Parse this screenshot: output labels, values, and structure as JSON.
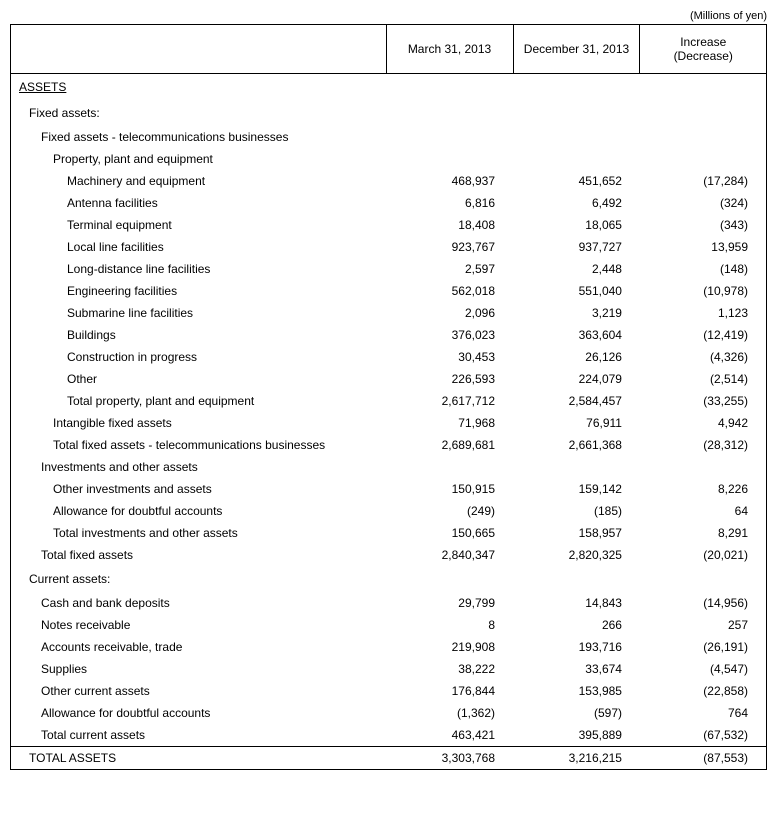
{
  "unit_label": "(Millions of yen)",
  "headers": {
    "col1": "March 31, 2013",
    "col2": "December 31, 2013",
    "col3": "Increase\n(Decrease)"
  },
  "section_assets": "ASSETS",
  "rows": {
    "fixed_assets": "Fixed assets:",
    "fa_telecom": "Fixed assets - telecommunications businesses",
    "ppe": "Property, plant and equipment",
    "machinery": {
      "label": "Machinery and equipment",
      "c1": "468,937",
      "c2": "451,652",
      "c3": "(17,284)"
    },
    "antenna": {
      "label": "Antenna facilities",
      "c1": "6,816",
      "c2": "6,492",
      "c3": "(324)"
    },
    "terminal": {
      "label": "Terminal equipment",
      "c1": "18,408",
      "c2": "18,065",
      "c3": "(343)"
    },
    "local": {
      "label": "Local line facilities",
      "c1": "923,767",
      "c2": "937,727",
      "c3": "13,959"
    },
    "longdist": {
      "label": "Long-distance line facilities",
      "c1": "2,597",
      "c2": "2,448",
      "c3": "(148)"
    },
    "engineering": {
      "label": "Engineering facilities",
      "c1": "562,018",
      "c2": "551,040",
      "c3": "(10,978)"
    },
    "submarine": {
      "label": "Submarine line facilities",
      "c1": "2,096",
      "c2": "3,219",
      "c3": "1,123"
    },
    "buildings": {
      "label": "Buildings",
      "c1": "376,023",
      "c2": "363,604",
      "c3": "(12,419)"
    },
    "cip": {
      "label": "Construction in progress",
      "c1": "30,453",
      "c2": "26,126",
      "c3": "(4,326)"
    },
    "other_ppe": {
      "label": "Other",
      "c1": "226,593",
      "c2": "224,079",
      "c3": "(2,514)"
    },
    "total_ppe": {
      "label": "Total property, plant and equipment",
      "c1": "2,617,712",
      "c2": "2,584,457",
      "c3": "(33,255)"
    },
    "intangible": {
      "label": "Intangible fixed assets",
      "c1": "71,968",
      "c2": "76,911",
      "c3": "4,942"
    },
    "total_fa_telecom": {
      "label": "Total fixed assets - telecommunications businesses",
      "c1": "2,689,681",
      "c2": "2,661,368",
      "c3": "(28,312)"
    },
    "inv_other": "Investments and other assets",
    "other_inv": {
      "label": "Other investments and assets",
      "c1": "150,915",
      "c2": "159,142",
      "c3": "8,226"
    },
    "allow_doubt_inv": {
      "label": "Allowance for doubtful accounts",
      "c1": "(249)",
      "c2": "(185)",
      "c3": "64"
    },
    "total_inv": {
      "label": "Total investments and other assets",
      "c1": "150,665",
      "c2": "158,957",
      "c3": "8,291"
    },
    "total_fixed": {
      "label": "Total fixed assets",
      "c1": "2,840,347",
      "c2": "2,820,325",
      "c3": "(20,021)"
    },
    "current_assets": "Current assets:",
    "cash": {
      "label": "Cash and bank deposits",
      "c1": "29,799",
      "c2": "14,843",
      "c3": "(14,956)"
    },
    "notes": {
      "label": "Notes receivable",
      "c1": "8",
      "c2": "266",
      "c3": "257"
    },
    "ar": {
      "label": "Accounts receivable, trade",
      "c1": "219,908",
      "c2": "193,716",
      "c3": "(26,191)"
    },
    "supplies": {
      "label": "Supplies",
      "c1": "38,222",
      "c2": "33,674",
      "c3": "(4,547)"
    },
    "other_cur": {
      "label": "Other current assets",
      "c1": "176,844",
      "c2": "153,985",
      "c3": "(22,858)"
    },
    "allow_doubt_cur": {
      "label": "Allowance for doubtful accounts",
      "c1": "(1,362)",
      "c2": "(597)",
      "c3": "764"
    },
    "total_cur": {
      "label": "Total current assets",
      "c1": "463,421",
      "c2": "395,889",
      "c3": "(67,532)"
    },
    "total_assets": {
      "label": "TOTAL ASSETS",
      "c1": "3,303,768",
      "c2": "3,216,215",
      "c3": "(87,553)"
    }
  }
}
